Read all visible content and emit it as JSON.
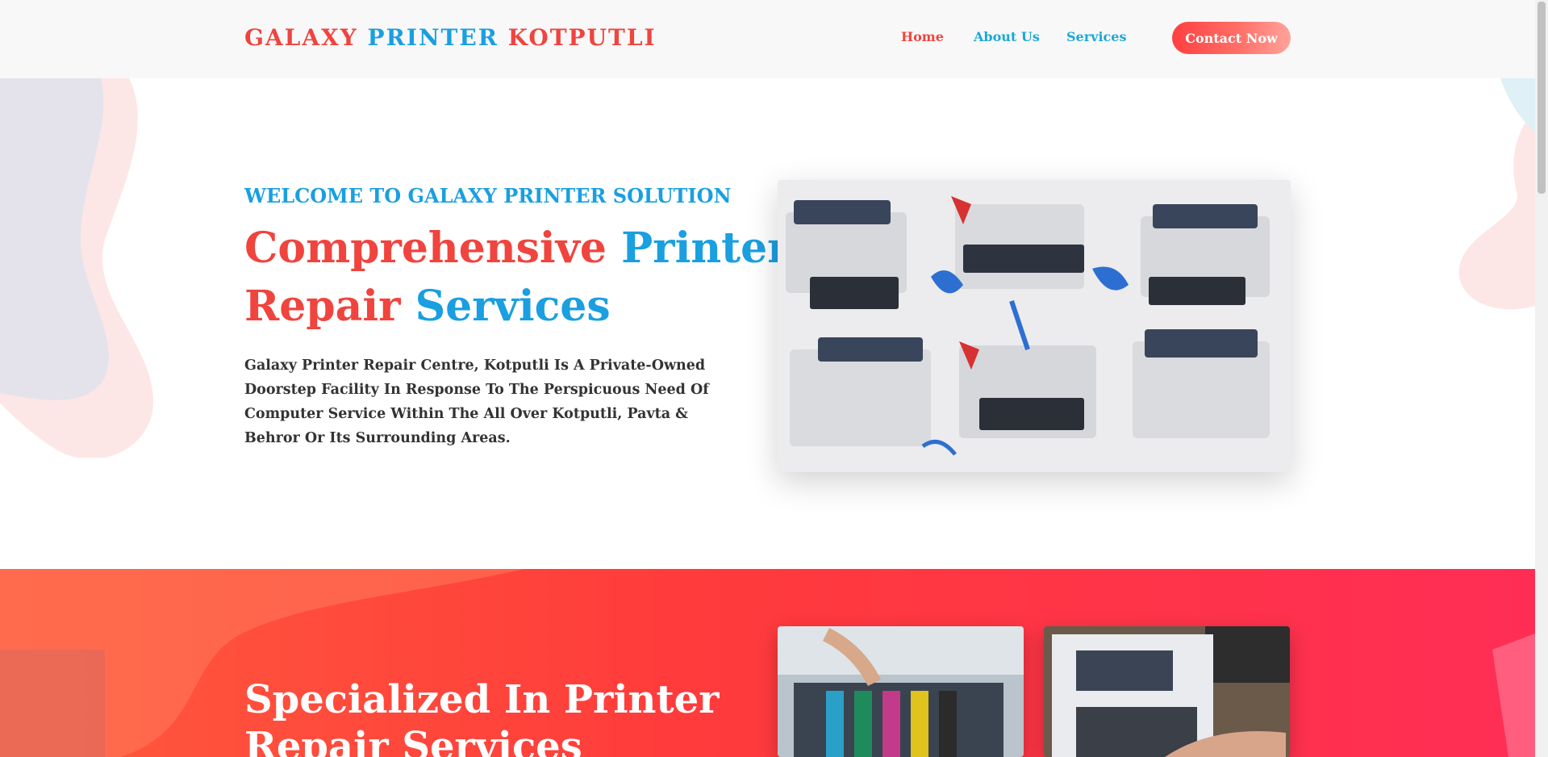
{
  "header": {
    "brand": {
      "word1": "GALAXY",
      "word2": "PRINTER",
      "word3": "KOTPUTLI"
    },
    "nav": {
      "home": "Home",
      "about": "About Us",
      "services": "Services"
    },
    "contact_button": "Contact Now"
  },
  "hero": {
    "welcome": "WELCOME TO GALAXY PRINTER SOLUTION",
    "title": {
      "w1": "Comprehensive",
      "w2": "Printer",
      "w3": "Repair",
      "w4": "Services"
    },
    "description": "Galaxy Printer Repair Centre, Kotputli Is A Private-Owned Doorstep Facility In Response To The Perspicuous Need Of Computer Service Within The All Over Kotputli, Pavta & Behror Or Its Surrounding Areas."
  },
  "specialized": {
    "title_line1": "Specialized In Printer",
    "title_line2": "Repair Services"
  },
  "colors": {
    "accent_red": "#f0443e",
    "accent_blue": "#1a9fe0",
    "section_gradient": [
      "#ff5a3c",
      "#ff2d55"
    ]
  }
}
